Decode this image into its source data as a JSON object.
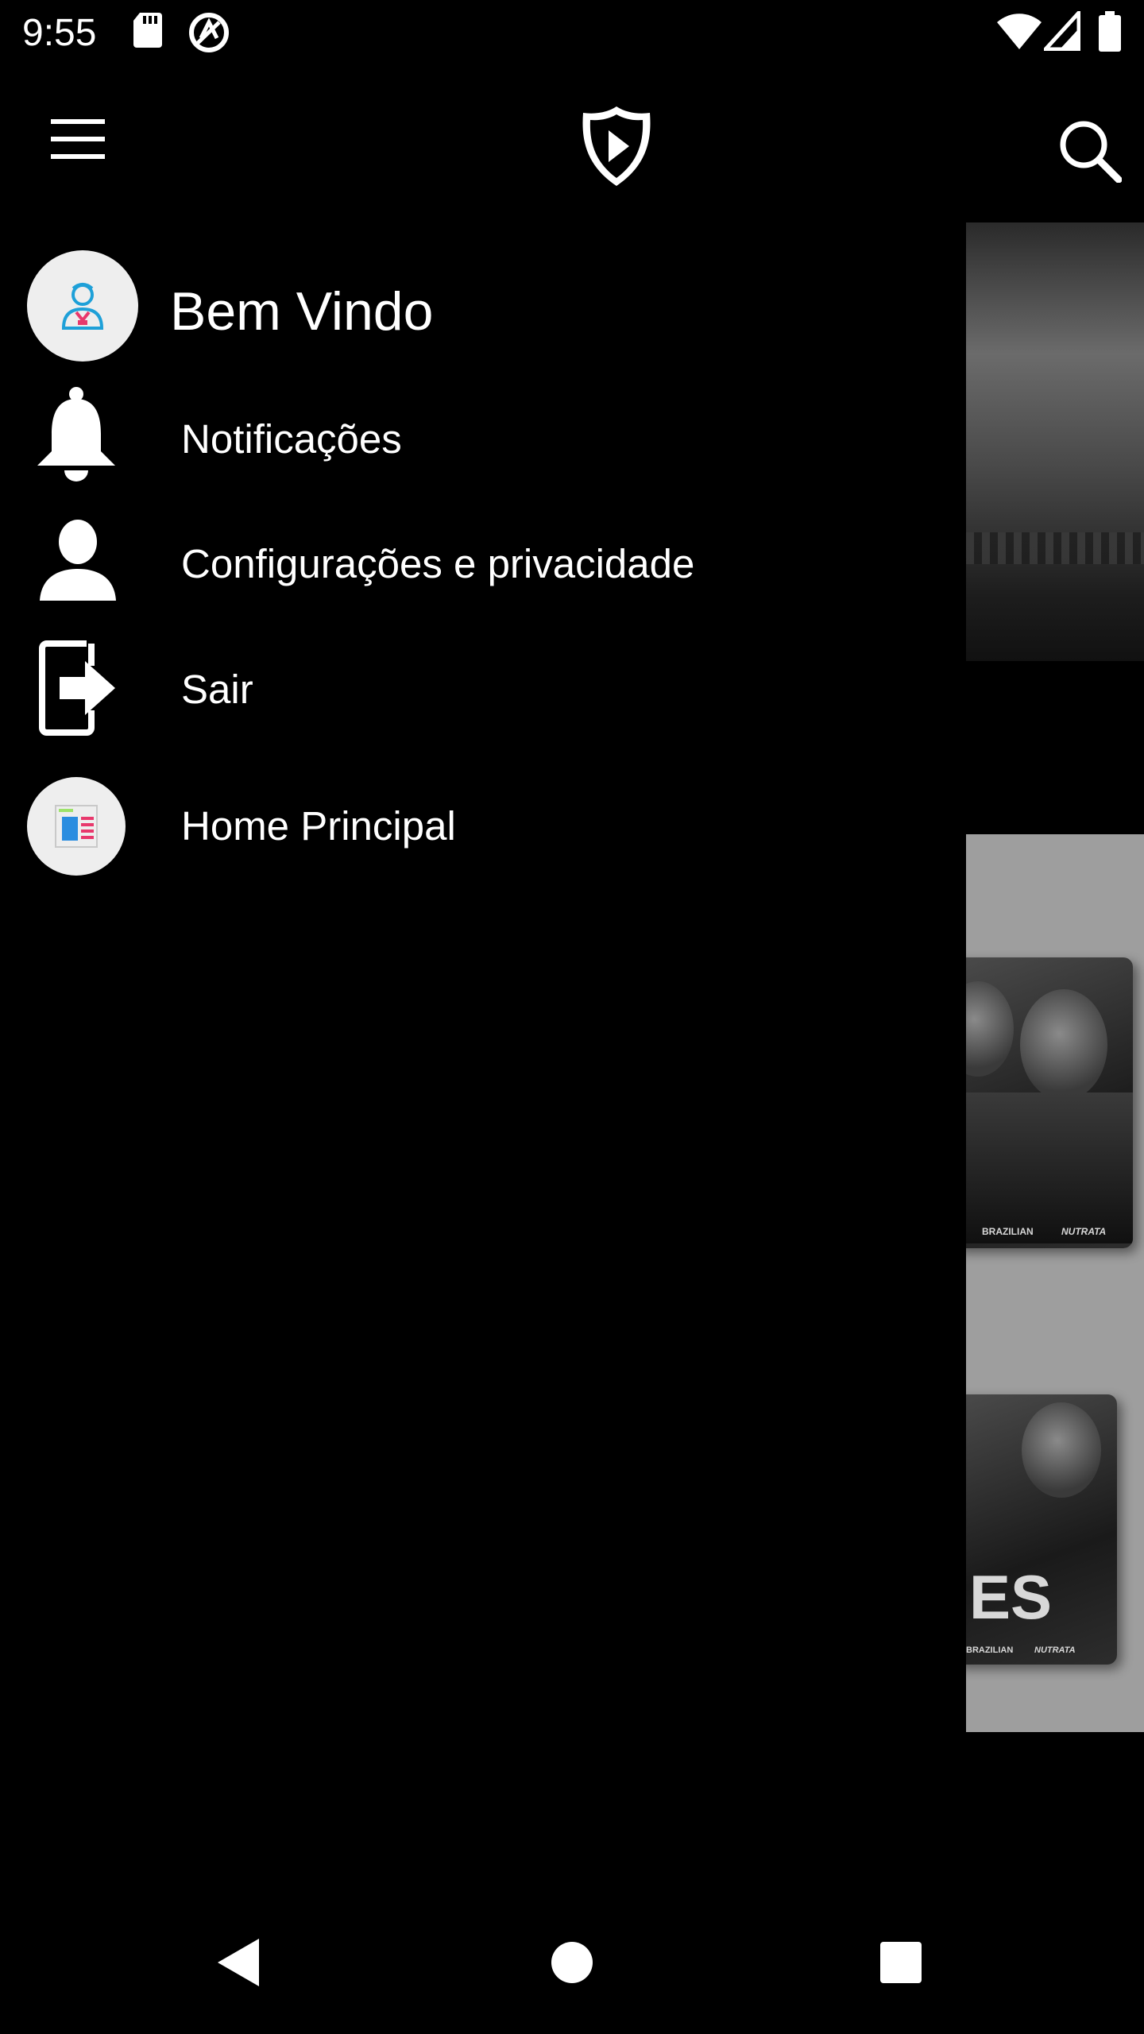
{
  "status_bar": {
    "time": "9:55",
    "icons": [
      "sd-card-icon",
      "vpn-icon",
      "wifi-icon",
      "signal-icon",
      "battery-icon"
    ]
  },
  "toolbar": {
    "menu_icon": "hamburger-menu-icon",
    "logo_icon": "shield-play-logo-icon",
    "search_icon": "search-icon"
  },
  "drawer": {
    "header": {
      "welcome": "Bem Vindo",
      "avatar_icon": "user-avatar-icon"
    },
    "items": [
      {
        "label": "Notificações",
        "icon": "bell-icon"
      },
      {
        "label": "Configurações e privacidade",
        "icon": "person-icon"
      },
      {
        "label": "Sair",
        "icon": "logout-icon"
      },
      {
        "label": "Home Principal",
        "icon": "home-page-icon"
      }
    ]
  },
  "background_content": {
    "card_1_text": "",
    "card_2_text": "ES",
    "sponsor_1": "BRAZILIAN",
    "sponsor_2": "NUTRATA"
  },
  "nav_bar": {
    "back_icon": "back-triangle-icon",
    "home_icon": "home-circle-icon",
    "recents_icon": "recents-square-icon"
  },
  "colors": {
    "background": "#000000",
    "text": "#ffffff",
    "avatar_bg": "#eeeeee",
    "content_panel": "#9e9e9e"
  }
}
